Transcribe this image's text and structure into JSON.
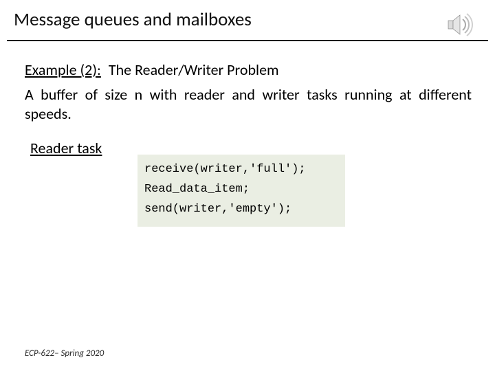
{
  "header": {
    "title": "Message queues and mailboxes"
  },
  "content": {
    "example_label": "Example (2):",
    "example_title": "The Reader/Writer Problem",
    "description": "A buffer of size n with reader and writer tasks running at different speeds.",
    "reader_task_label": "Reader task",
    "code": [
      "receive(writer,'full');",
      "Read_data_item;",
      "send(writer,'empty');"
    ]
  },
  "footer": {
    "text": "ECP-622– Spring 2020"
  }
}
